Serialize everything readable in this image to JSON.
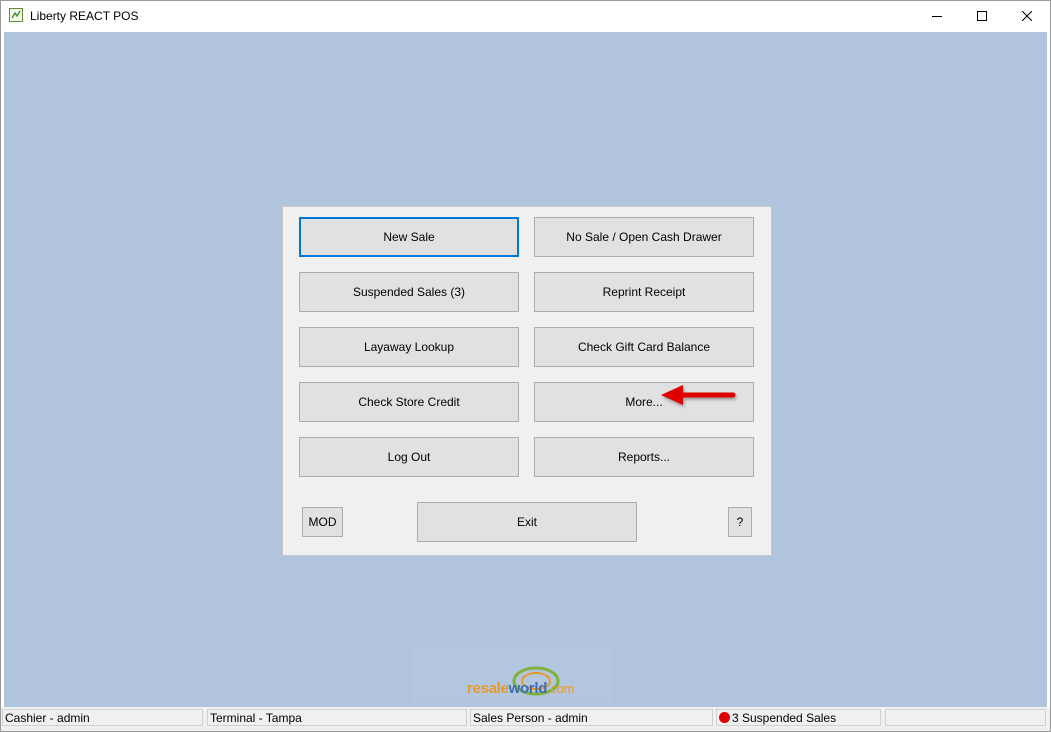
{
  "window": {
    "title": "Liberty REACT POS",
    "controls": [
      "minimize-icon",
      "maximize-icon",
      "close-icon"
    ]
  },
  "menu": {
    "new_sale": "New Sale",
    "no_sale": "No Sale / Open Cash Drawer",
    "suspended_sales": "Suspended Sales (3)",
    "reprint_receipt": "Reprint Receipt",
    "layaway_lookup": "Layaway Lookup",
    "check_gift_card": "Check Gift Card Balance",
    "check_store_credit": "Check Store Credit",
    "more": "More...",
    "log_out": "Log Out",
    "reports": "Reports...",
    "mod": "MOD",
    "exit": "Exit",
    "help": "?"
  },
  "logo": {
    "resale": "resale",
    "world": "world",
    "com": ".com"
  },
  "statusbar": {
    "cashier": "Cashier - admin",
    "terminal": "Terminal - Tampa",
    "sales_person": "Sales Person - admin",
    "suspended": "3 Suspended Sales",
    "empty": ""
  },
  "colors": {
    "client_background": "#b0c4de",
    "default_button_border": "#0078d7",
    "status_dot": "#e00000",
    "annotation_arrow": "#e00000"
  }
}
